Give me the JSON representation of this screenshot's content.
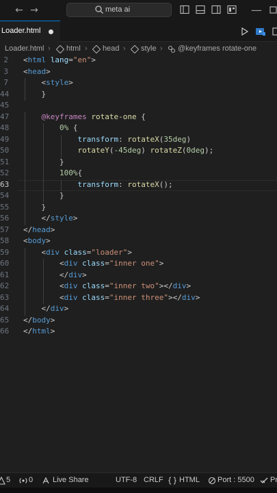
{
  "titlebar": {
    "search_text": "meta ai"
  },
  "tab": {
    "label": "Loader.html"
  },
  "breadcrumb": {
    "items": [
      "Loader.html",
      "html",
      "head",
      "style",
      "@keyframes rotate-one"
    ]
  },
  "editor": {
    "active_line": "63",
    "lines": [
      {
        "n": "2",
        "tokens": [
          [
            "t-punc",
            "<"
          ],
          [
            "t-tag",
            "html"
          ],
          [
            "t-txt",
            " "
          ],
          [
            "t-attr",
            "lang"
          ],
          [
            "t-punc",
            "="
          ],
          [
            "t-str",
            "\"en\""
          ],
          [
            "t-punc",
            ">"
          ]
        ],
        "indent": 0
      },
      {
        "n": "3",
        "tokens": [
          [
            "t-punc",
            "<"
          ],
          [
            "t-tag",
            "head"
          ],
          [
            "t-punc",
            ">"
          ]
        ],
        "indent": 0
      },
      {
        "n": "7",
        "tokens": [
          [
            "t-punc",
            "<"
          ],
          [
            "t-tag",
            "style"
          ],
          [
            "t-punc",
            ">"
          ]
        ],
        "indent": 1
      },
      {
        "n": "44",
        "tokens": [
          [
            "t-punc",
            "}"
          ]
        ],
        "indent": 1
      },
      {
        "n": "45",
        "tokens": [],
        "indent": 0
      },
      {
        "n": "47",
        "tokens": [
          [
            "t-at",
            "@keyframes"
          ],
          [
            "t-txt",
            " "
          ],
          [
            "t-name",
            "rotate-one"
          ],
          [
            "t-txt",
            " "
          ],
          [
            "t-punc",
            "{"
          ]
        ],
        "indent": 1
      },
      {
        "n": "48",
        "tokens": [
          [
            "t-num",
            "0%"
          ],
          [
            "t-txt",
            " "
          ],
          [
            "t-punc",
            "{"
          ]
        ],
        "indent": 2
      },
      {
        "n": "49",
        "tokens": [
          [
            "t-prop",
            "transform"
          ],
          [
            "t-punc",
            ": "
          ],
          [
            "t-func",
            "rotateX"
          ],
          [
            "t-punc",
            "("
          ],
          [
            "t-num",
            "35deg"
          ],
          [
            "t-punc",
            ")"
          ]
        ],
        "indent": 3
      },
      {
        "n": "50",
        "tokens": [
          [
            "t-func",
            "rotateY"
          ],
          [
            "t-punc",
            "("
          ],
          [
            "t-num",
            "-45deg"
          ],
          [
            "t-punc",
            ")"
          ],
          [
            "t-txt",
            " "
          ],
          [
            "t-func",
            "rotateZ"
          ],
          [
            "t-punc",
            "("
          ],
          [
            "t-num",
            "0deg"
          ],
          [
            "t-punc",
            ");"
          ]
        ],
        "indent": 3
      },
      {
        "n": "51",
        "tokens": [
          [
            "t-punc",
            "}"
          ]
        ],
        "indent": 2
      },
      {
        "n": "52",
        "tokens": [
          [
            "t-num",
            "100%"
          ],
          [
            "t-punc",
            "{"
          ]
        ],
        "indent": 2
      },
      {
        "n": "63",
        "tokens": [
          [
            "t-prop",
            "transform"
          ],
          [
            "t-punc",
            ": "
          ],
          [
            "t-func",
            "rotateX"
          ],
          [
            "t-punc",
            "();"
          ]
        ],
        "indent": 3
      },
      {
        "n": "54",
        "tokens": [
          [
            "t-punc",
            "}"
          ]
        ],
        "indent": 2
      },
      {
        "n": "55",
        "tokens": [
          [
            "t-punc",
            "}"
          ]
        ],
        "indent": 1
      },
      {
        "n": "56",
        "tokens": [
          [
            "t-punc",
            "</"
          ],
          [
            "t-tag",
            "style"
          ],
          [
            "t-punc",
            ">"
          ]
        ],
        "indent": 1
      },
      {
        "n": "57",
        "tokens": [
          [
            "t-punc",
            "</"
          ],
          [
            "t-tag",
            "head"
          ],
          [
            "t-punc",
            ">"
          ]
        ],
        "indent": 0
      },
      {
        "n": "58",
        "tokens": [
          [
            "t-punc",
            "<"
          ],
          [
            "t-tag",
            "body"
          ],
          [
            "t-punc",
            ">"
          ]
        ],
        "indent": 0
      },
      {
        "n": "59",
        "tokens": [
          [
            "t-punc",
            "<"
          ],
          [
            "t-tag",
            "div"
          ],
          [
            "t-txt",
            " "
          ],
          [
            "t-attr",
            "class"
          ],
          [
            "t-punc",
            "="
          ],
          [
            "t-str",
            "\"loader\""
          ],
          [
            "t-punc",
            ">"
          ]
        ],
        "indent": 1
      },
      {
        "n": "60",
        "tokens": [
          [
            "t-punc",
            "<"
          ],
          [
            "t-tag",
            "div"
          ],
          [
            "t-txt",
            " "
          ],
          [
            "t-attr",
            "class"
          ],
          [
            "t-punc",
            "="
          ],
          [
            "t-str",
            "\"inner one\""
          ],
          [
            "t-punc",
            ">"
          ]
        ],
        "indent": 2
      },
      {
        "n": "61",
        "tokens": [
          [
            "t-punc",
            "</"
          ],
          [
            "t-tag",
            "div"
          ],
          [
            "t-punc",
            ">"
          ]
        ],
        "indent": 2
      },
      {
        "n": "62",
        "tokens": [
          [
            "t-punc",
            "<"
          ],
          [
            "t-tag",
            "div"
          ],
          [
            "t-txt",
            " "
          ],
          [
            "t-attr",
            "class"
          ],
          [
            "t-punc",
            "="
          ],
          [
            "t-str",
            "\"inner two\""
          ],
          [
            "t-punc",
            "></"
          ],
          [
            "t-tag",
            "div"
          ],
          [
            "t-punc",
            ">"
          ]
        ],
        "indent": 2
      },
      {
        "n": "63",
        "tokens": [
          [
            "t-punc",
            "<"
          ],
          [
            "t-tag",
            "div"
          ],
          [
            "t-txt",
            " "
          ],
          [
            "t-attr",
            "class"
          ],
          [
            "t-punc",
            "="
          ],
          [
            "t-str",
            "\"inner three\""
          ],
          [
            "t-punc",
            "></"
          ],
          [
            "t-tag",
            "div"
          ],
          [
            "t-punc",
            ">"
          ]
        ],
        "indent": 2
      },
      {
        "n": "64",
        "tokens": [
          [
            "t-punc",
            "</"
          ],
          [
            "t-tag",
            "div"
          ],
          [
            "t-punc",
            ">"
          ]
        ],
        "indent": 1
      },
      {
        "n": "65",
        "tokens": [
          [
            "t-punc",
            "</"
          ],
          [
            "t-tag",
            "body"
          ],
          [
            "t-punc",
            ">"
          ]
        ],
        "indent": 0
      },
      {
        "n": "66",
        "tokens": [
          [
            "t-punc",
            "</"
          ],
          [
            "t-tag",
            "html"
          ],
          [
            "t-punc",
            ">"
          ]
        ],
        "indent": 0
      }
    ]
  },
  "statusbar": {
    "problems": "5",
    "ports": "0",
    "live_share": "Live Share",
    "encoding": "UTF-8",
    "eol": "CRLF",
    "language": "HTML",
    "port": "Port : 5500",
    "prettier": "Pr"
  },
  "colors": {
    "accent": "#0078d4",
    "background": "#1f1f1f",
    "chrome": "#181818"
  }
}
